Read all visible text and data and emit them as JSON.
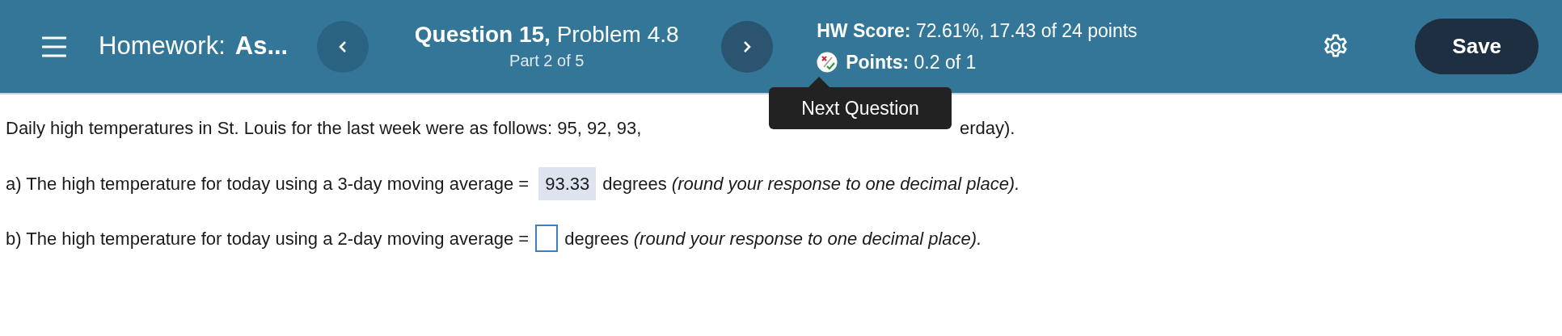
{
  "header": {
    "title_label": "Homework:",
    "title_value": "As...",
    "question_title": "**Question 15,** Problem 4.8",
    "question_part": "Part 2 of 5",
    "score": "**HW Score:** 72.61%, 17.43 of 24 points",
    "points": "**Points:** 0.2 of 1",
    "save_button": "Save"
  },
  "tooltip": {
    "text": "Next Question"
  },
  "intro_visible_parts": [
    "Daily high temperatures in St. Louis for the last week were as follows: 95, 92, 93,",
    "erday)."
  ],
  "questions": [
    {
      "kind": "filled",
      "prefix": "a) The high temperature for today using a 3-day moving average =",
      "answer": "93.33",
      "suffix": "degrees *(round your response to one decimal place).*"
    },
    {
      "kind": "empty",
      "prefix": "b) The high temperature for today using a 2-day moving average =",
      "suffix": "degrees *(round your response to one decimal place).*"
    }
  ]
}
